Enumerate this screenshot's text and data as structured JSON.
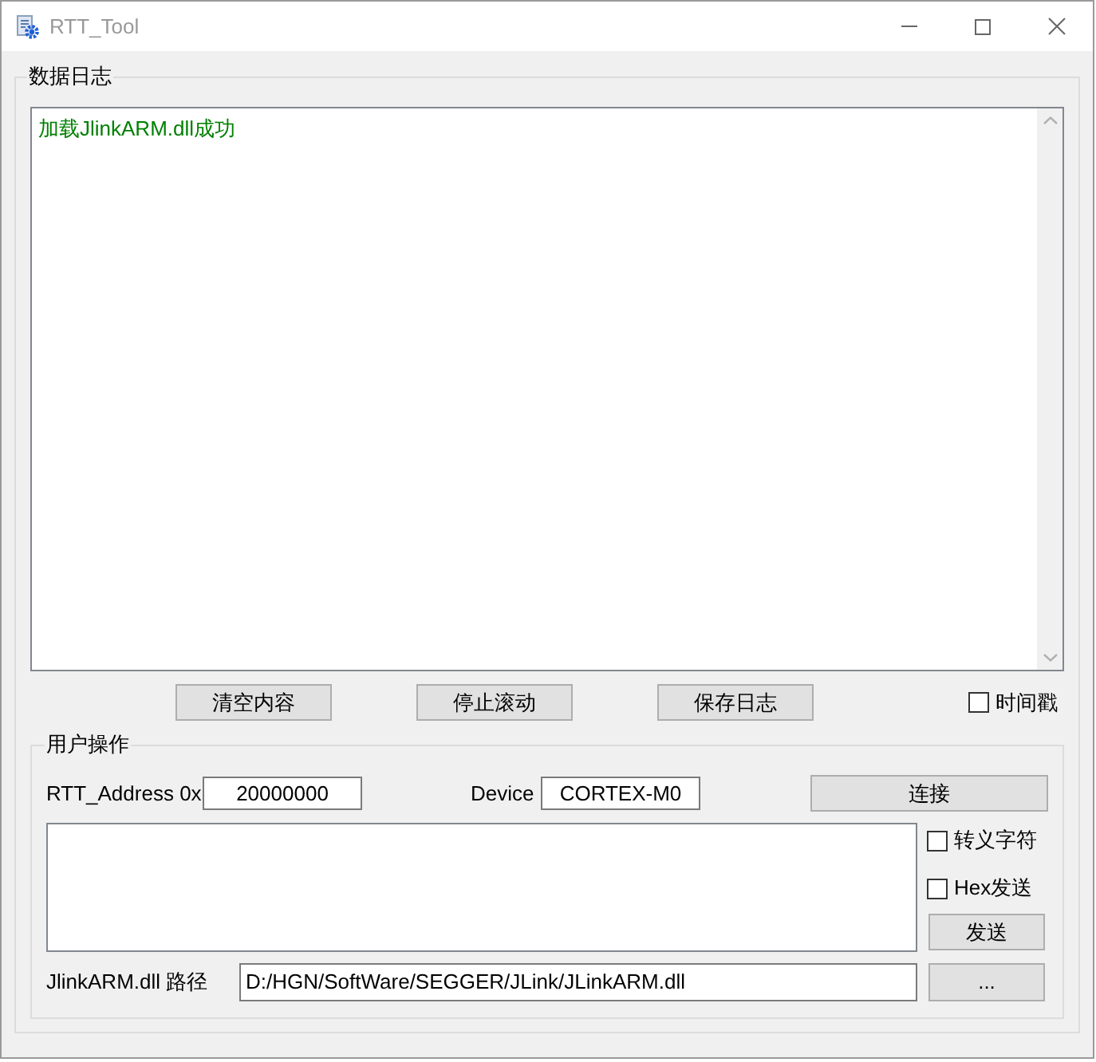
{
  "window": {
    "title": "RTT_Tool"
  },
  "log_group": {
    "title": "数据日志",
    "lines": [
      "加载JlinkARM.dll成功"
    ]
  },
  "log_buttons": [
    "清空内容",
    "停止滚动",
    "保存日志"
  ],
  "timestamp": {
    "label": "时间戳",
    "checked": false
  },
  "user_group": {
    "title": "用户操作",
    "address_label": "RTT_Address 0x",
    "address_value": "20000000",
    "device_label": "Device",
    "device_value": "CORTEX-M0",
    "connect_button": "连接",
    "options": [
      {
        "label": "转义字符",
        "checked": false
      },
      {
        "label": "Hex发送",
        "checked": false
      }
    ],
    "send_button": "发送",
    "path_label": "JlinkARM.dll 路径",
    "path_value": "D:/HGN/SoftWare/SEGGER/JLink/JLinkARM.dll",
    "browse_button": "..."
  }
}
